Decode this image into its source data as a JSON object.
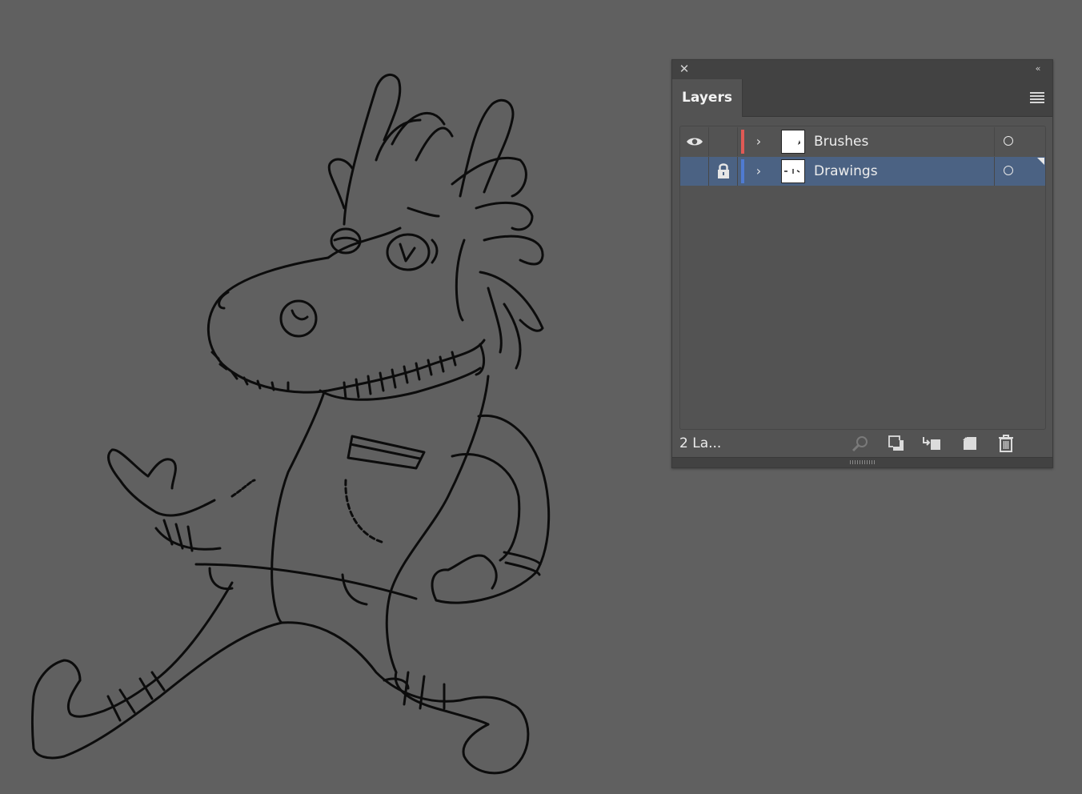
{
  "app": {
    "background_color": "#606060"
  },
  "layers_panel": {
    "tab_label": "Layers",
    "close_icon": "close-icon",
    "collapse_icon": "collapse-panel-icon",
    "menu_icon": "panel-menu-icon",
    "layers": [
      {
        "name": "Brushes",
        "visible": true,
        "locked": false,
        "selected": false,
        "color": "#e05a55"
      },
      {
        "name": "Drawings",
        "visible": false,
        "locked": true,
        "selected": true,
        "color": "#4f7bd1"
      }
    ],
    "footer": {
      "count_label": "2 La...",
      "buttons": [
        "locate-object-icon",
        "make-clipping-mask-icon",
        "create-sublayer-icon",
        "create-new-layer-icon",
        "delete-icon"
      ]
    },
    "selection_color": "#4b6283"
  }
}
